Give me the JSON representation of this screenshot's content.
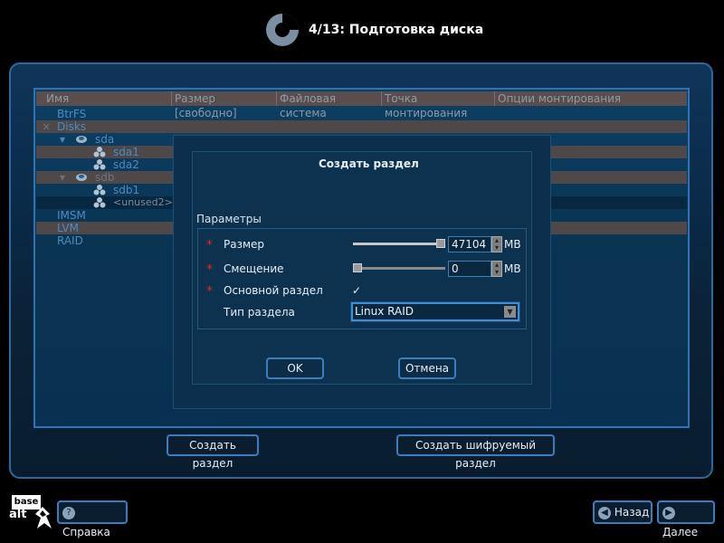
{
  "header": {
    "step_title": "4/13: Подготовка диска"
  },
  "tree": {
    "columns": [
      "Имя",
      "Размер [свободно]",
      "Файловая система",
      "Точка монтирования",
      "Опции монтирования"
    ],
    "rows": [
      {
        "label": "BtrFS",
        "indent": 0
      },
      {
        "label": "Disks",
        "indent": 0,
        "expander": "×"
      },
      {
        "label": "sda",
        "indent": 1,
        "expander": "▾",
        "icon": "disk-group-icon"
      },
      {
        "label": "sda1",
        "indent": 2,
        "icon": "partition-icon"
      },
      {
        "label": "sda2",
        "indent": 2,
        "icon": "partition-icon"
      },
      {
        "label": "sdb",
        "indent": 1,
        "expander": "▾",
        "icon": "disk-group-icon"
      },
      {
        "label": "sdb1",
        "indent": 2,
        "icon": "partition-icon"
      },
      {
        "label": "<unused2>",
        "indent": 2,
        "icon": "partition-icon"
      },
      {
        "label": "IMSM",
        "indent": 0
      },
      {
        "label": "LVM",
        "indent": 0
      },
      {
        "label": "RAID",
        "indent": 0
      }
    ]
  },
  "dialog": {
    "title": "Создать раздел",
    "params_label": "Параметры",
    "size": {
      "label": "Размер",
      "value": "47104",
      "unit": "MB",
      "slider_level": 1.0
    },
    "offset": {
      "label": "Смещение",
      "value": "0",
      "unit": "MB",
      "slider_level": 0.0
    },
    "primary": {
      "label": "Основной раздел",
      "checked": true,
      "mark": "✓"
    },
    "type": {
      "label": "Тип раздела",
      "value": "Linux RAID"
    },
    "ok_label": "OK",
    "cancel_label": "Отмена",
    "required_mark": "*"
  },
  "actions": {
    "create_partition": "Создать раздел",
    "create_encrypted": "Создать шифруемый раздел"
  },
  "footer": {
    "logo_text_top": "base",
    "logo_text_bottom": "alt",
    "help_label": "Справка",
    "back_label": "Назад",
    "next_label": "Далее"
  }
}
